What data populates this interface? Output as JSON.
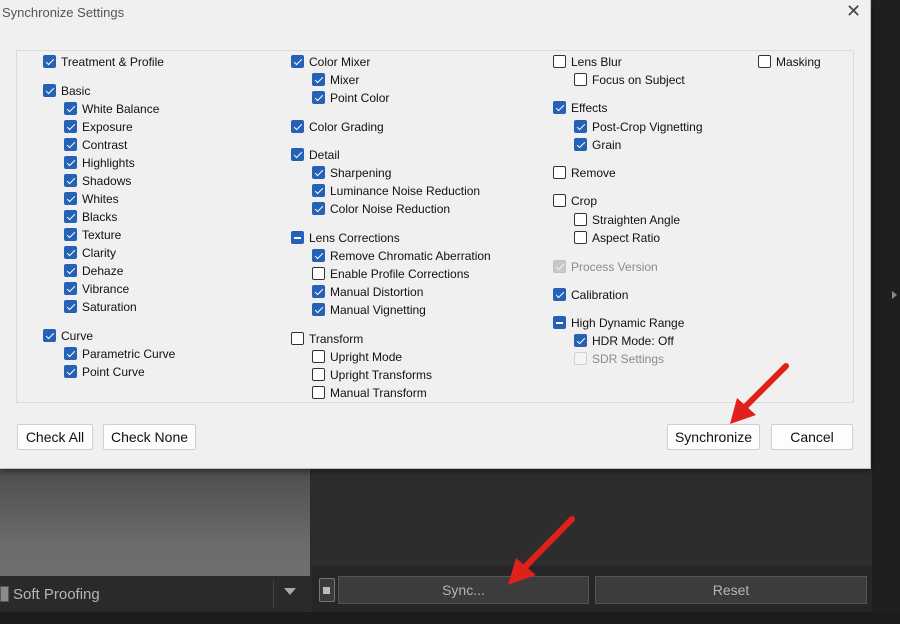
{
  "dialog": {
    "title": "Synchronize Settings",
    "close_icon": "close-icon",
    "buttons": {
      "check_all": "Check All",
      "check_none": "Check None",
      "synchronize": "Synchronize",
      "cancel": "Cancel"
    }
  },
  "settings": [
    {
      "label": "Treatment & Profile",
      "state": "checked"
    },
    {
      "label": "Basic",
      "state": "checked"
    },
    {
      "label": "White Balance",
      "state": "checked"
    },
    {
      "label": "Exposure",
      "state": "checked"
    },
    {
      "label": "Contrast",
      "state": "checked"
    },
    {
      "label": "Highlights",
      "state": "checked"
    },
    {
      "label": "Shadows",
      "state": "checked"
    },
    {
      "label": "Whites",
      "state": "checked"
    },
    {
      "label": "Blacks",
      "state": "checked"
    },
    {
      "label": "Texture",
      "state": "checked"
    },
    {
      "label": "Clarity",
      "state": "checked"
    },
    {
      "label": "Dehaze",
      "state": "checked"
    },
    {
      "label": "Vibrance",
      "state": "checked"
    },
    {
      "label": "Saturation",
      "state": "checked"
    },
    {
      "label": "Curve",
      "state": "checked"
    },
    {
      "label": "Parametric Curve",
      "state": "checked"
    },
    {
      "label": "Point Curve",
      "state": "checked"
    },
    {
      "label": "Color Mixer",
      "state": "checked"
    },
    {
      "label": "Mixer",
      "state": "checked"
    },
    {
      "label": "Point Color",
      "state": "checked"
    },
    {
      "label": "Color Grading",
      "state": "checked"
    },
    {
      "label": "Detail",
      "state": "checked"
    },
    {
      "label": "Sharpening",
      "state": "checked"
    },
    {
      "label": "Luminance Noise Reduction",
      "state": "checked"
    },
    {
      "label": "Color Noise Reduction",
      "state": "checked"
    },
    {
      "label": "Lens Corrections",
      "state": "mixed"
    },
    {
      "label": "Remove Chromatic Aberration",
      "state": "checked"
    },
    {
      "label": "Enable Profile Corrections",
      "state": "unchecked"
    },
    {
      "label": "Manual Distortion",
      "state": "checked"
    },
    {
      "label": "Manual Vignetting",
      "state": "checked"
    },
    {
      "label": "Transform",
      "state": "unchecked"
    },
    {
      "label": "Upright Mode",
      "state": "unchecked"
    },
    {
      "label": "Upright Transforms",
      "state": "unchecked"
    },
    {
      "label": "Manual Transform",
      "state": "unchecked"
    },
    {
      "label": "Lens Blur",
      "state": "unchecked"
    },
    {
      "label": "Focus on Subject",
      "state": "unchecked"
    },
    {
      "label": "Effects",
      "state": "checked"
    },
    {
      "label": "Post-Crop Vignetting",
      "state": "checked"
    },
    {
      "label": "Grain",
      "state": "checked"
    },
    {
      "label": "Remove",
      "state": "unchecked"
    },
    {
      "label": "Crop",
      "state": "unchecked"
    },
    {
      "label": "Straighten Angle",
      "state": "unchecked"
    },
    {
      "label": "Aspect Ratio",
      "state": "unchecked"
    },
    {
      "label": "Process Version",
      "state": "disabled-checked"
    },
    {
      "label": "Calibration",
      "state": "checked"
    },
    {
      "label": "High Dynamic Range",
      "state": "mixed"
    },
    {
      "label": "HDR Mode: Off",
      "state": "checked"
    },
    {
      "label": "SDR Settings",
      "state": "disabled"
    },
    {
      "label": "Masking",
      "state": "unchecked"
    }
  ],
  "background": {
    "soft_proofing_label": "Soft Proofing",
    "sync_button": "Sync...",
    "reset_button": "Reset"
  },
  "annotations": {
    "arrow_color": "#e0201b",
    "arrow_icon": "red-arrow-icon"
  },
  "colors": {
    "accent": "#2561b4",
    "dialog_bg": "#f0f0f0"
  }
}
